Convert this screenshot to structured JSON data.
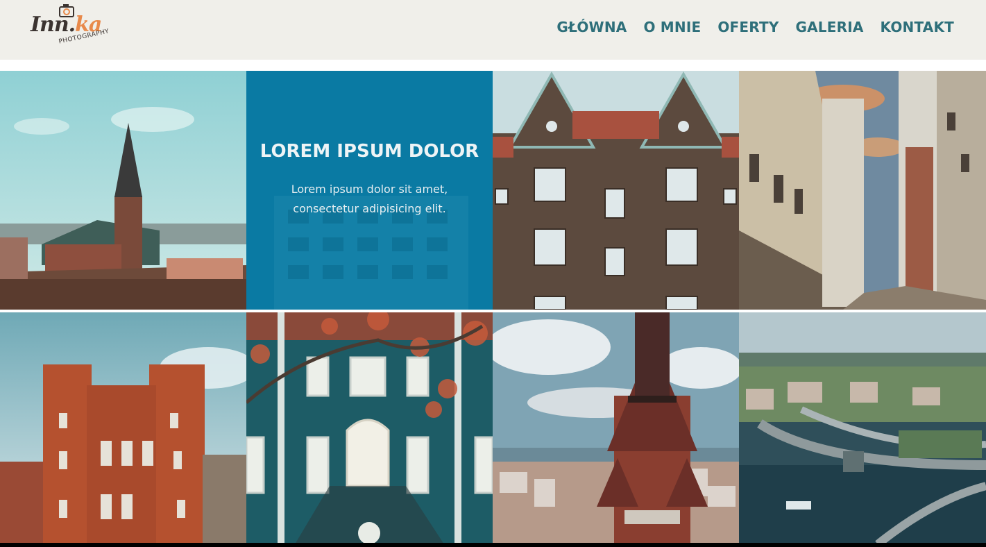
{
  "logo": {
    "script_main": "Inn",
    "script_accent": "ka",
    "subtitle": "PHOTOGRAPHY",
    "icon": "camera-icon"
  },
  "nav": {
    "items": [
      {
        "label": "GŁÓWNA"
      },
      {
        "label": "O MNIE"
      },
      {
        "label": "OFERTY"
      },
      {
        "label": "GALERIA"
      },
      {
        "label": "KONTAKT"
      }
    ]
  },
  "colors": {
    "header_bg": "#f0efea",
    "nav_text": "#2e6f7a",
    "overlay_blue": "#0a7aa3"
  },
  "feature": {
    "title": "LOREM IPSUM DOLOR",
    "text": "Lorem ipsum dolor sit amet, consectetur adipisicing elit."
  }
}
